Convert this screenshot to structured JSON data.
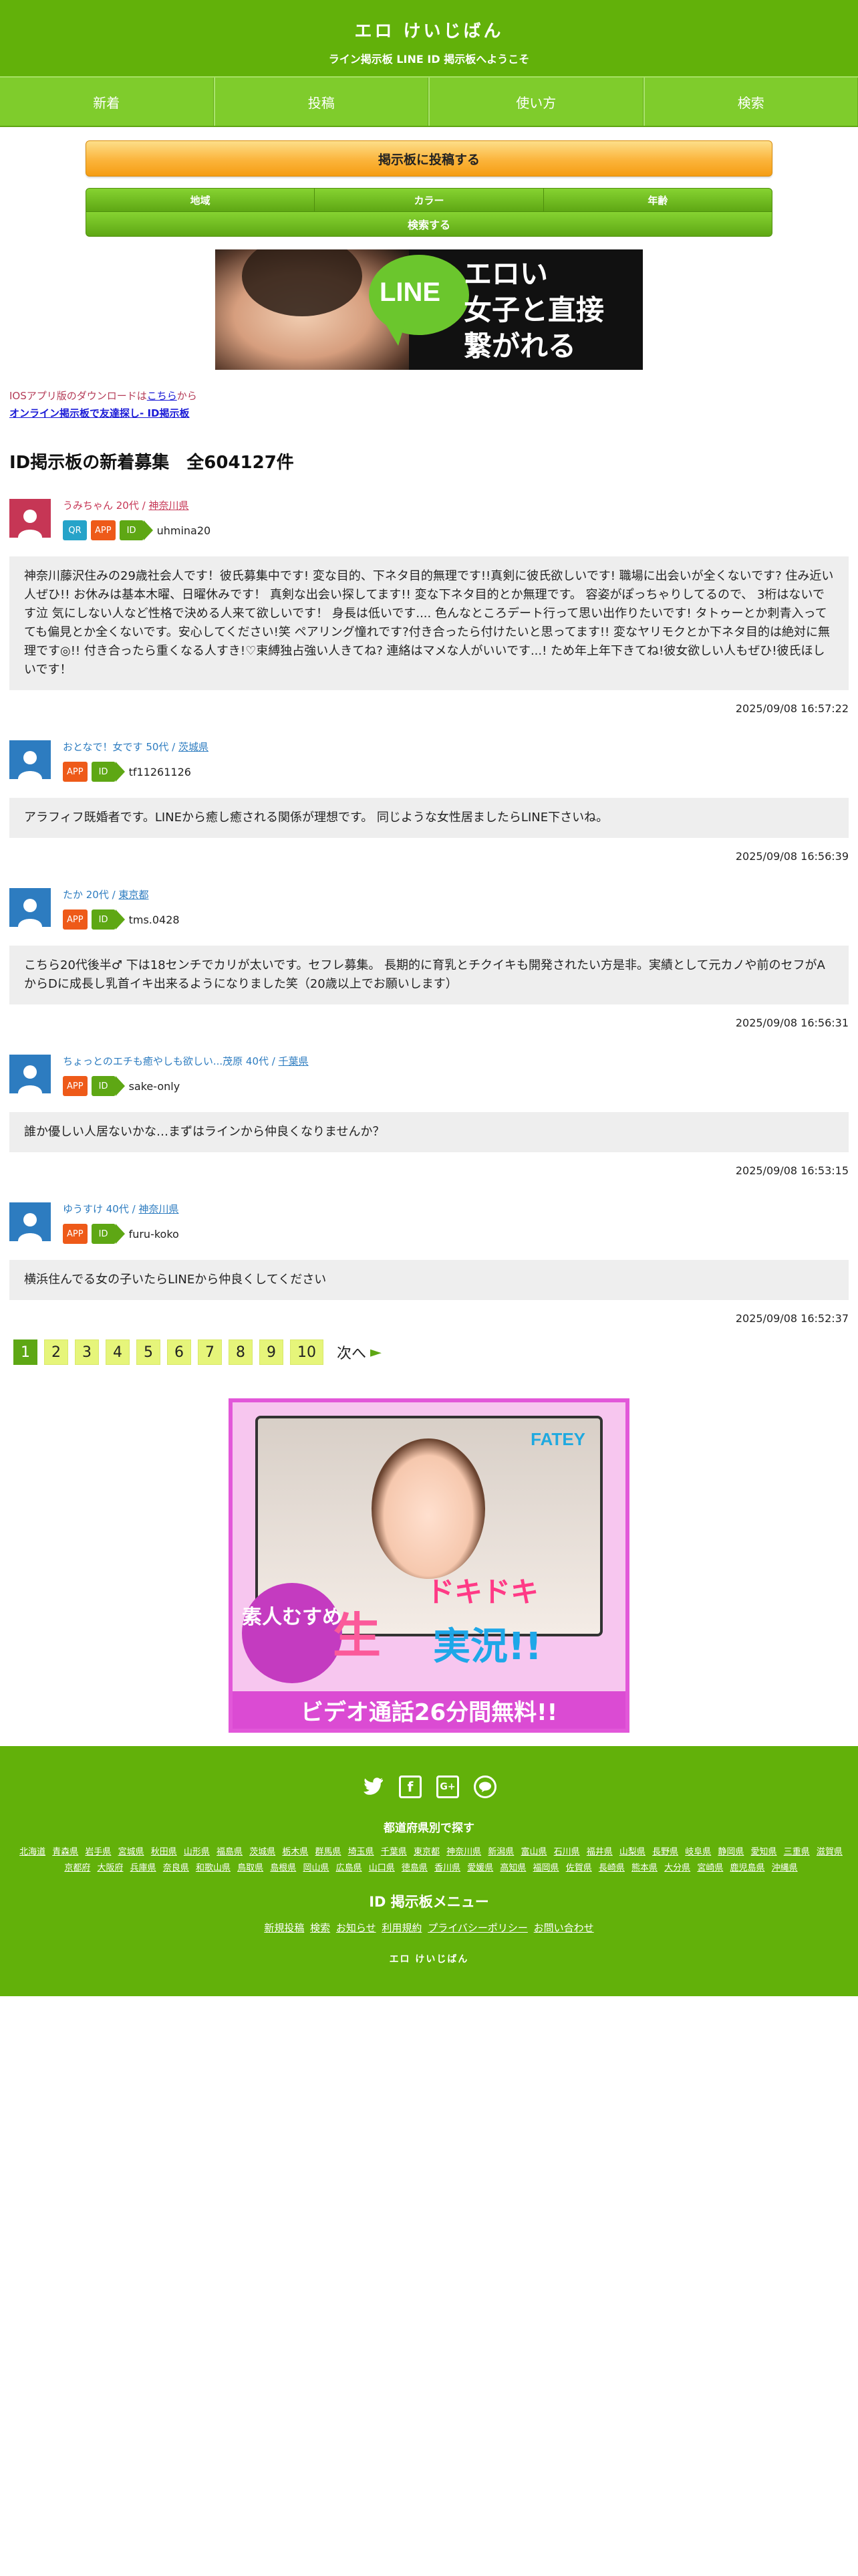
{
  "header": {
    "logo": "エロ けいじばん",
    "subtitle": "ライン掲示板 LINE ID 掲示板へようこそ"
  },
  "nav": [
    "新着",
    "投稿",
    "使い方",
    "検索"
  ],
  "post_button": "掲示板に投稿する",
  "search": {
    "region": "地域",
    "color": "カラー",
    "age": "年齢",
    "submit": "検索する"
  },
  "banner": {
    "line_logo": "LINE",
    "text_line1": "エロい",
    "text_line2": "女子と直接",
    "text_line3": "繋がれる"
  },
  "links": {
    "ios_prefix": "IOSアプリ版のダウンロードは",
    "ios_link": "こちら",
    "ios_suffix": "から",
    "online": "オンライン掲示板で友達探し- ID掲示板"
  },
  "section_title": "ID掲示板の新着募集　全604127件",
  "posts": [
    {
      "gender": "female",
      "name": "うみちゃん 20代 / ",
      "pref": "神奈川県",
      "badges": [
        "QR",
        "APP",
        "ID"
      ],
      "line_id": "uhmina20",
      "body": "神奈川藤沢住みの29歳社会人です！彼氏募集中です! 変な目的、下ネタ目的無理です!!真剣に彼氏欲しいです! 職場に出会いが全くないです? 住み近い人ぜひ!! お休みは基本木曜、日曜休みです！ 真剣な出会い探してます!! 変な下ネタ目的とか無理です。 容姿がぽっちゃりしてるので、 3桁はないです泣 気にしない人など性格で決める人来て欲しいです！ 身長は低いです.... 色んなところデート行って思い出作りたいです! タトゥーとか刺青入ってても偏見とか全くないです。安心してください!笑 ペアリング憧れです?付き合ったら付けたいと思ってます!! 変なヤリモクとか下ネタ目的は絶対に無理です◎!! 付き合ったら重くなる人すき!♡束縛独占強い人きてね? 連絡はマメな人がいいです...! ため年上年下きてね!彼女欲しい人もぜひ!彼氏ほしいです！",
      "date": "2025/09/08 16:57:22"
    },
    {
      "gender": "male",
      "name": "おとなで！女です 50代 / ",
      "pref": "茨城県",
      "badges": [
        "APP",
        "ID"
      ],
      "line_id": "tf11261126",
      "body": "アラフィフ既婚者です。LINEから癒し癒される関係が理想です。 同じような女性居ましたらLINE下さいね。",
      "date": "2025/09/08 16:56:39"
    },
    {
      "gender": "male",
      "name": "たか 20代 / ",
      "pref": "東京都",
      "badges": [
        "APP",
        "ID"
      ],
      "line_id": "tms.0428",
      "body": "こちら20代後半♂ 下は18センチでカリが太いです。セフレ募集。 長期的に育乳とチクイキも開発されたい方是非。実績として元カノや前のセフがAからDに成長し乳首イキ出来るようになりました笑（20歳以上でお願いします）",
      "date": "2025/09/08 16:56:31"
    },
    {
      "gender": "male",
      "name": "ちょっとのエチも癒やしも欲しい...茂原 40代 / ",
      "pref": "千葉県",
      "badges": [
        "APP",
        "ID"
      ],
      "line_id": "sake-only",
      "body": "誰か優しい人居ないかな…まずはラインから仲良くなりませんか？",
      "date": "2025/09/08 16:53:15"
    },
    {
      "gender": "male",
      "name": "ゆうすけ 40代 / ",
      "pref": "神奈川県",
      "badges": [
        "APP",
        "ID"
      ],
      "line_id": "furu-koko",
      "body": "横浜住んでる女の子いたらLINEから仲良くしてください",
      "date": "2025/09/08 16:52:37"
    }
  ],
  "pager": {
    "pages": [
      "1",
      "2",
      "3",
      "4",
      "5",
      "6",
      "7",
      "8",
      "9",
      "10"
    ],
    "current": "1",
    "next": "次へ"
  },
  "ad": {
    "logo": "FATEY",
    "circle": "素人むすめ",
    "title1": "生",
    "title2": "ドキドキ",
    "title3": "実況!!",
    "footer": "ビデオ通話26分間無料!!"
  },
  "footer": {
    "social_icons": [
      "twitter-icon",
      "facebook-icon",
      "google-plus-icon",
      "line-icon"
    ],
    "pref_heading": "都道府県別で探す",
    "prefectures": [
      "北海道",
      "青森県",
      "岩手県",
      "宮城県",
      "秋田県",
      "山形県",
      "福島県",
      "茨城県",
      "栃木県",
      "群馬県",
      "埼玉県",
      "千葉県",
      "東京都",
      "神奈川県",
      "新潟県",
      "富山県",
      "石川県",
      "福井県",
      "山梨県",
      "長野県",
      "岐阜県",
      "静岡県",
      "愛知県",
      "三重県",
      "滋賀県",
      "京都府",
      "大阪府",
      "兵庫県",
      "奈良県",
      "和歌山県",
      "鳥取県",
      "島根県",
      "岡山県",
      "広島県",
      "山口県",
      "徳島県",
      "香川県",
      "愛媛県",
      "高知県",
      "福岡県",
      "佐賀県",
      "長崎県",
      "熊本県",
      "大分県",
      "宮崎県",
      "鹿児島県",
      "沖縄県"
    ],
    "menu_heading": "ID 掲示板メニュー",
    "menu": [
      "新規投稿",
      "検索",
      "お知らせ",
      "利用規約",
      "プライバシーポリシー",
      "お問い合わせ"
    ],
    "logo": "エロ けいじばん"
  },
  "colors": {
    "brand_green": "#62b10a",
    "nav_green": "#7fcc2c",
    "post_button_orange": "#fbb43b",
    "female_accent": "#c63655",
    "male_accent": "#2d7cc0",
    "app_badge": "#ee5a19",
    "qr_badge": "#26a3c9",
    "pager_yellow": "#e6f57a"
  }
}
